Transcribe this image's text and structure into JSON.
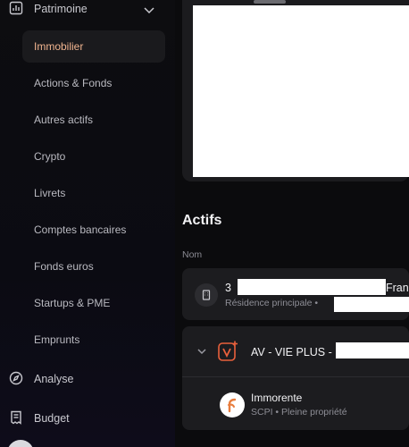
{
  "sidebar": {
    "group_title": "Patrimoine",
    "items": [
      {
        "label": "Immobilier",
        "active": true
      },
      {
        "label": "Actions & Fonds"
      },
      {
        "label": "Autres actifs"
      },
      {
        "label": "Crypto"
      },
      {
        "label": "Livrets"
      },
      {
        "label": "Comptes bancaires"
      },
      {
        "label": "Fonds euros"
      },
      {
        "label": "Startups & PME"
      },
      {
        "label": "Emprunts"
      }
    ],
    "analyse_label": "Analyse",
    "budget_label": "Budget"
  },
  "main": {
    "section_title": "Actifs",
    "column_name": "Nom",
    "assets": [
      {
        "name_prefix": "3",
        "name_suffix": "Franc",
        "subtitle": "Résidence principale •",
        "icon": "building-icon"
      },
      {
        "name": "AV - VIE PLUS -",
        "icon": "vie-plus-logo",
        "children": [
          {
            "name": "Immorente",
            "subtitle": "SCPI • Pleine propriété",
            "icon": "sofidy-logo"
          }
        ]
      }
    ]
  },
  "colors": {
    "accent": "#f0b48f",
    "active_bg": "#1a1a1d",
    "card_bg": "#1c1c1f"
  }
}
